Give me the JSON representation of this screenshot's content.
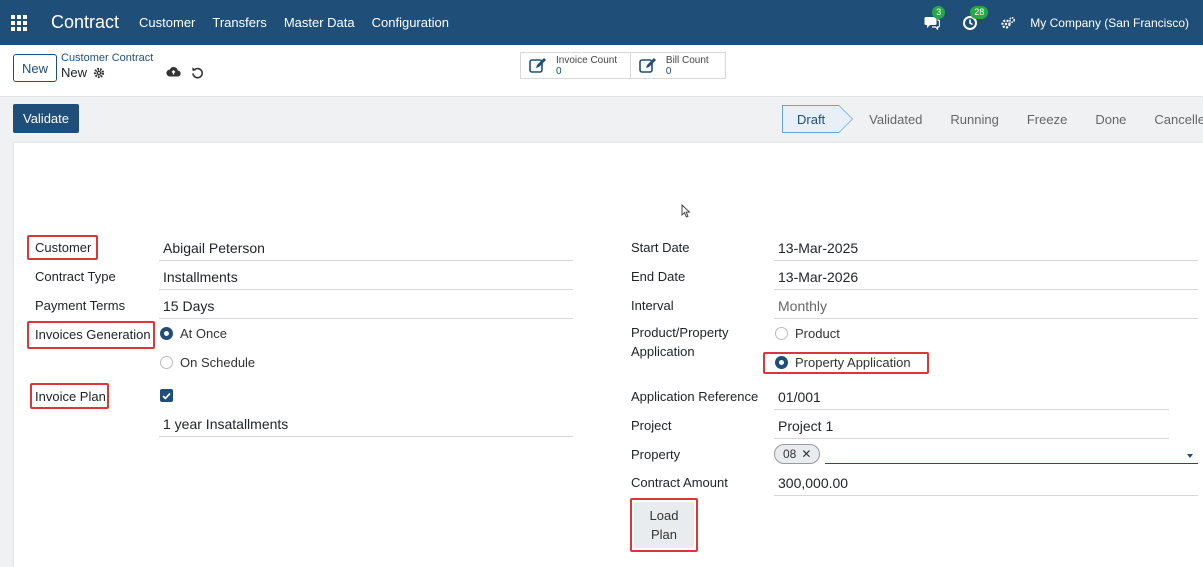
{
  "navbar": {
    "app_title": "Contract",
    "menu": [
      "Customer",
      "Transfers",
      "Master Data",
      "Configuration"
    ],
    "messages_count": "3",
    "activities_count": "28",
    "company": "My Company (San Francisco)"
  },
  "control": {
    "new_label": "New",
    "breadcrumb_parent": "Customer Contract",
    "breadcrumb_current": "New",
    "invoice_count_label": "Invoice Count",
    "invoice_count_value": "0",
    "bill_count_label": "Bill Count",
    "bill_count_value": "0"
  },
  "actions": {
    "validate_label": "Validate",
    "load_plan_label": "Load Plan"
  },
  "statusbar": {
    "stages": [
      "Draft",
      "Validated",
      "Running",
      "Freeze",
      "Done",
      "Cancelled"
    ],
    "active": "Draft"
  },
  "left_fields": {
    "customer_label": "Customer",
    "customer_value": "Abigail Peterson",
    "contract_type_label": "Contract Type",
    "contract_type_value": "Installments",
    "payment_terms_label": "Payment Terms",
    "payment_terms_value": "15 Days",
    "invoices_generation_label": "Invoices Generation",
    "invoices_generation_options": [
      "At Once",
      "On Schedule"
    ],
    "invoices_generation_selected": "At Once",
    "invoice_plan_label": "Invoice Plan",
    "invoice_plan_checked": true,
    "invoice_plan_value": "1 year Insatallments"
  },
  "right_fields": {
    "start_date_label": "Start Date",
    "start_date_value": "13-Mar-2025",
    "end_date_label": "End Date",
    "end_date_value": "13-Mar-2026",
    "interval_label": "Interval",
    "interval_value": "Monthly",
    "product_property_label_1": "Product/Property",
    "product_property_label_2": "Application",
    "product_property_options": [
      "Product",
      "Property Application"
    ],
    "product_property_selected": "Property Application",
    "application_reference_label": "Application Reference",
    "application_reference_value": "01/001",
    "project_label": "Project",
    "project_value": "Project 1",
    "property_label": "Property",
    "property_tag": "08",
    "contract_amount_label": "Contract Amount",
    "contract_amount_value": "300,000.00"
  },
  "colors": {
    "primary": "#1f4e79",
    "highlight": "#d9383a",
    "badge": "#28a745"
  }
}
